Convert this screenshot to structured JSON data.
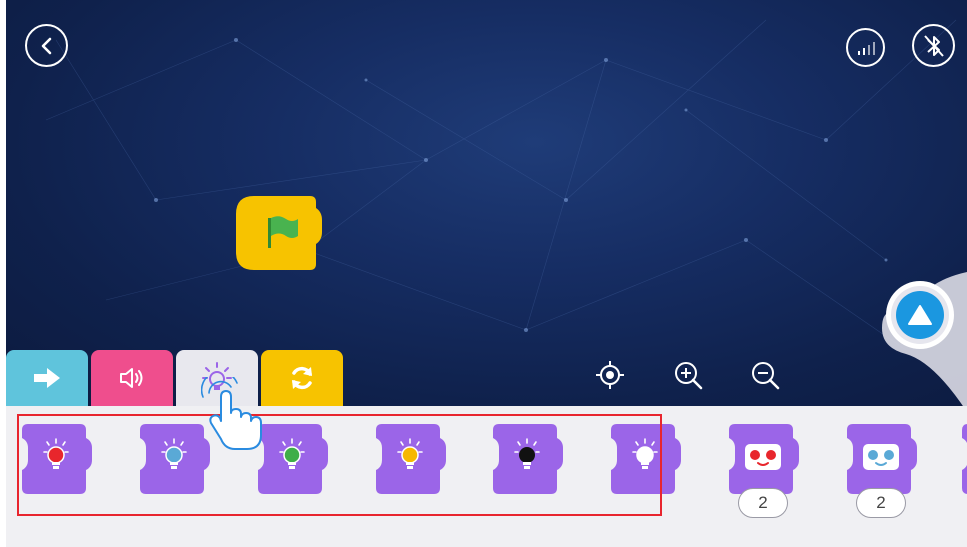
{
  "workspace": {
    "start_block_icon": "green-flag-icon"
  },
  "header": {
    "back_icon": "back-arrow-icon",
    "signal_icon": "signal-strength-icon",
    "bluetooth_icon": "bluetooth-disabled-icon"
  },
  "category_tabs": [
    {
      "name": "motion",
      "icon": "arrow-right-icon",
      "color": "#5fc4dc"
    },
    {
      "name": "sound",
      "icon": "speaker-icon",
      "color": "#ef4e8d"
    },
    {
      "name": "lights",
      "icon": "lightbulb-icon",
      "color": "#e8e8ee",
      "selected": true
    },
    {
      "name": "control",
      "icon": "refresh-icon",
      "color": "#f7c300"
    }
  ],
  "zoom_controls": [
    "center-target-icon",
    "zoom-in-icon",
    "zoom-out-icon"
  ],
  "palette_blocks": [
    {
      "icon": "bulb-red-icon",
      "color": "#e8262c"
    },
    {
      "icon": "bulb-blue-icon",
      "color": "#5aa9d6"
    },
    {
      "icon": "bulb-green-icon",
      "color": "#3fae49"
    },
    {
      "icon": "bulb-yellow-icon",
      "color": "#f6b800"
    },
    {
      "icon": "bulb-black-icon",
      "color": "#111111"
    },
    {
      "icon": "bulb-white-icon",
      "color": "#ffffff"
    },
    {
      "icon": "robot-eyes-red-icon",
      "color": "#e8262c",
      "count": "2"
    },
    {
      "icon": "robot-eyes-blue-icon",
      "color": "#5aa9d6",
      "count": "2"
    }
  ],
  "colors": {
    "block_purple": "#9b65e8",
    "start_yellow": "#f7c300",
    "highlight": "#e8252e",
    "play_blue": "#1b97e0"
  }
}
